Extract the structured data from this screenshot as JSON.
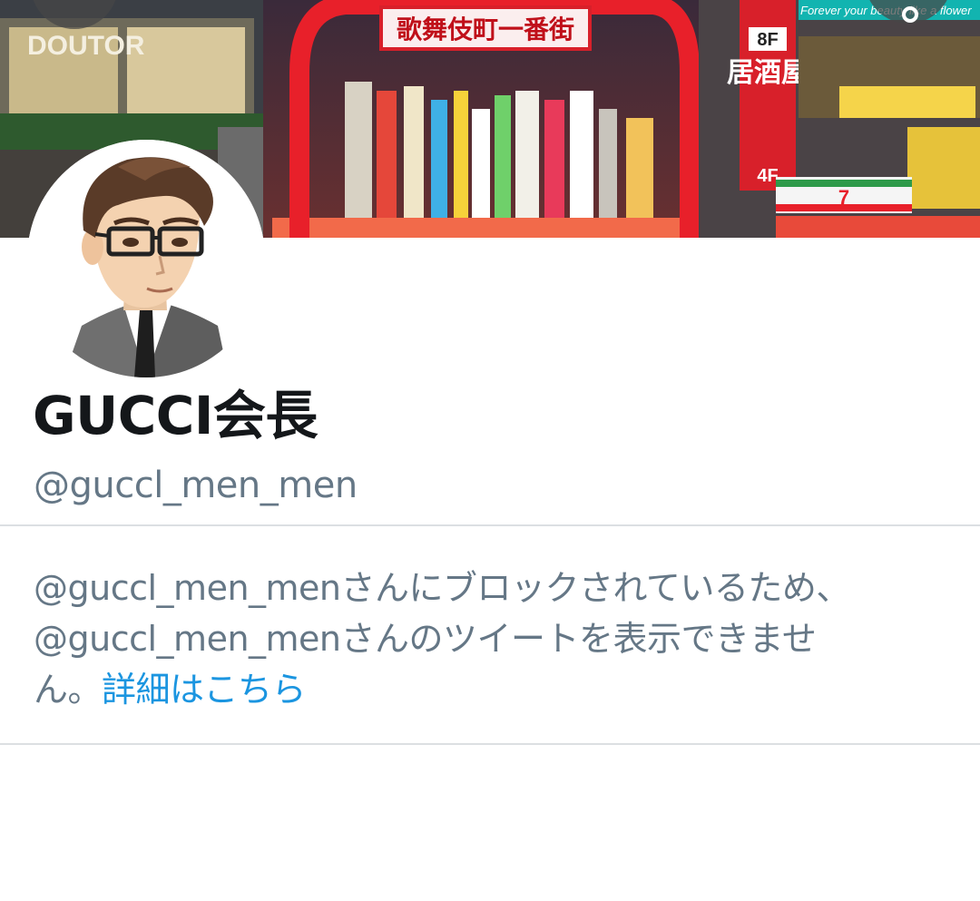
{
  "profile": {
    "display_name": "GUCCI会長",
    "screen_name": "@guccl_men_men"
  },
  "banner": {
    "sign_main": "歌舞伎町一番街",
    "sign_floor": "8F",
    "sign_izakaya": "居酒屋",
    "sign_floor_lower": "4F",
    "sign_top_right": "Forever your beauty like a flower",
    "sign_cafe": "DOUTOR",
    "store_number": "7"
  },
  "blocked": {
    "line1": "@guccl_men_menさんにブロックされているため、",
    "line2": "@guccl_men_menさんのツイートを表示できませ",
    "line3": "ん。",
    "link": "詳細はこちら"
  },
  "colors": {
    "text_primary": "#14171a",
    "text_secondary": "#657786",
    "link": "#1b95e0",
    "divider": "#dcdfe2"
  },
  "icons": {
    "back": "back-arrow-icon",
    "more": "more-options-icon"
  }
}
